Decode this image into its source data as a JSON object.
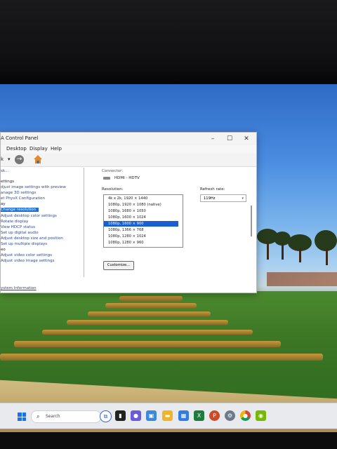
{
  "window": {
    "title": "A Control Panel",
    "minimize": "–",
    "maximize": "☐",
    "close": "✕"
  },
  "menubar": [
    "Desktop",
    "Display",
    "Help"
  ],
  "toolbar": {
    "back_text": "k",
    "dropdown": "▾",
    "back_icon": "back-icon",
    "home_icon": "home-icon"
  },
  "sidebar": {
    "items": [
      "sk...",
      "ettings",
      "djust image settings with preview",
      "anage 3D settings",
      "et PhysX Configuration",
      "ay",
      "Change resolution",
      "Adjust desktop color settings",
      "Rotate display",
      "View HDCP status",
      "Set up digital audio",
      "Adjust desktop size and position",
      "Set up multiple displays",
      "eo",
      "Adjust video color settings",
      "Adjust video image settings"
    ],
    "selected": "Change resolution",
    "system_info": "ystem Information"
  },
  "content": {
    "connector_label": "Connector:",
    "connector_value": "HDMI - HDTV",
    "resolution_label": "Resolution:",
    "resolutions": [
      "4k x 2k, 1920 × 1440",
      "1080p, 1920 × 1080 (native)",
      "1080p, 1680 × 1050",
      "1080p, 1600 × 1024",
      "1080p, 1600 × 900",
      "1080p, 1366 × 768",
      "1080p, 1280 × 1024",
      "1080p, 1280 × 960"
    ],
    "selected_resolution": "1080p, 1600 × 900",
    "refresh_label": "Refresh rate:",
    "refresh_value": "119Hz",
    "customize": "Customize..."
  },
  "taskbar": {
    "search_placeholder": "Search",
    "apps": [
      "task-view",
      "files",
      "chat",
      "photos",
      "file-explorer",
      "store",
      "excel",
      "powerpoint",
      "settings",
      "chrome",
      "nvidia"
    ]
  },
  "colors": {
    "selection": "#1a5fd0",
    "accent": "#1e6fd6",
    "nvidia": "#76b900"
  }
}
